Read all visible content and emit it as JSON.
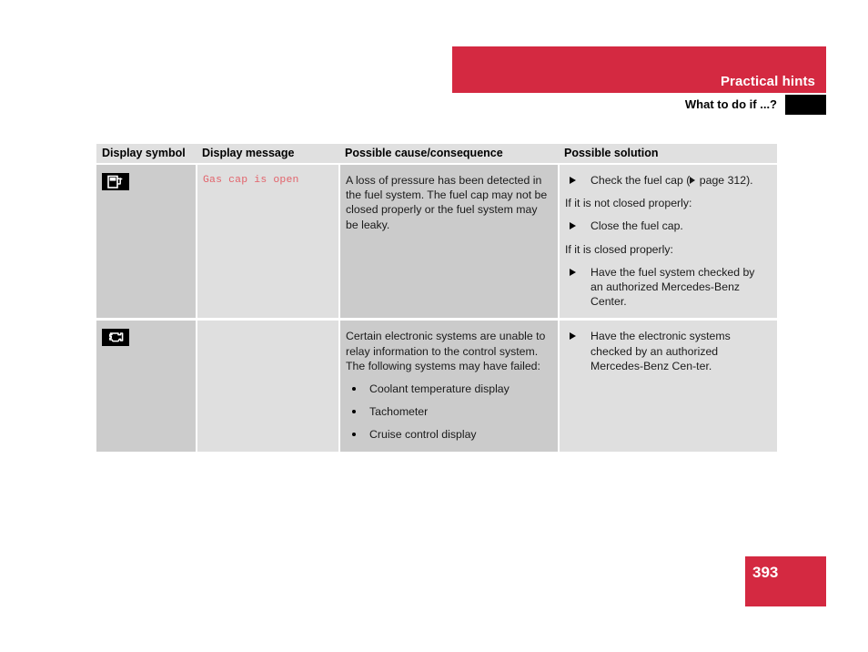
{
  "header": {
    "section_title": "Practical hints",
    "sub_title": "What to do if ...?"
  },
  "table": {
    "columns": [
      "Display symbol",
      "Display message",
      "Possible cause/consequence",
      "Possible solution"
    ],
    "rows": [
      {
        "symbol_icon": "fuel-cap-icon",
        "message": "Gas cap is open",
        "cause": {
          "paragraph": "A loss of pressure has been detected in the fuel system. The fuel cap may not be closed properly or the fuel system may be leaky.",
          "bullets": []
        },
        "solution": {
          "steps": [
            {
              "type": "action",
              "text": "Check the fuel cap (",
              "ref": " page 312)."
            },
            {
              "type": "note",
              "text": "If it is not closed properly:"
            },
            {
              "type": "action",
              "text": "Close the fuel cap."
            },
            {
              "type": "note",
              "text": "If it is closed properly:"
            },
            {
              "type": "action",
              "text": "Have the fuel system checked by an authorized Mercedes-Benz Center."
            }
          ]
        }
      },
      {
        "symbol_icon": "check-engine-icon",
        "message": "",
        "cause": {
          "paragraph": "Certain electronic systems are unable to relay information to the control system. The following systems may have failed:",
          "bullets": [
            "Coolant temperature display",
            "Tachometer",
            "Cruise control display"
          ]
        },
        "solution": {
          "steps": [
            {
              "type": "action",
              "text": "Have the electronic systems checked by an authorized Mercedes-Benz Cen-ter."
            }
          ]
        }
      }
    ]
  },
  "footer": {
    "page_number": "393"
  },
  "colors": {
    "accent_red": "#d42941",
    "message_red": "#e2636b",
    "header_row": "#e0e0e0",
    "col_symbol": "#cccccc",
    "col_light": "#dfdfdf",
    "col_cause": "#cbcbcb"
  }
}
